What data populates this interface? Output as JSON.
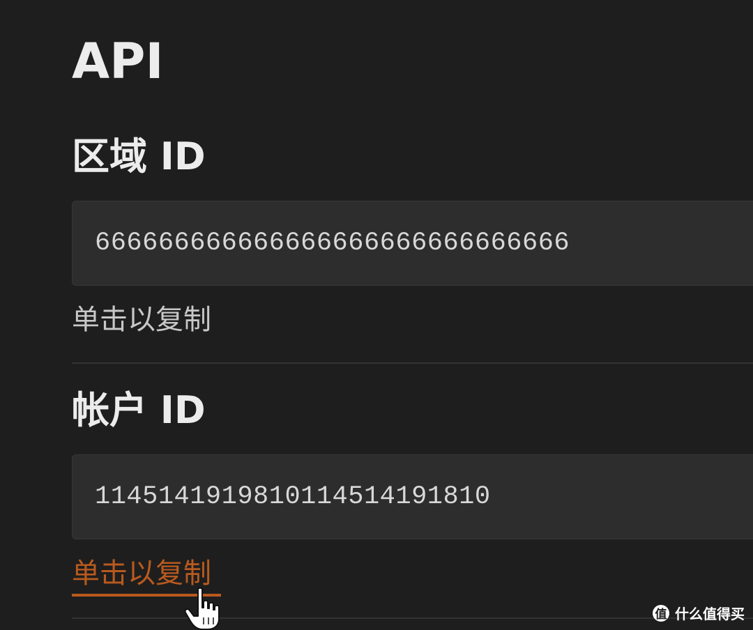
{
  "page": {
    "title": "API"
  },
  "region": {
    "label": "区域 ID",
    "value": "666666666666666666666666666666",
    "copy_hint": "单击以复制"
  },
  "account": {
    "label": "帐户 ID",
    "value": "114514191981011451419181​0",
    "copy_hint": "单击以复制"
  },
  "watermark": {
    "logo_glyph": "值",
    "text": "什么值得买"
  },
  "colors": {
    "background": "#1e1e1e",
    "box": "#2d2d2d",
    "link_active": "#b85a1e",
    "text": "#ececec"
  },
  "icons": {
    "cursor": "hand-pointer-icon"
  }
}
